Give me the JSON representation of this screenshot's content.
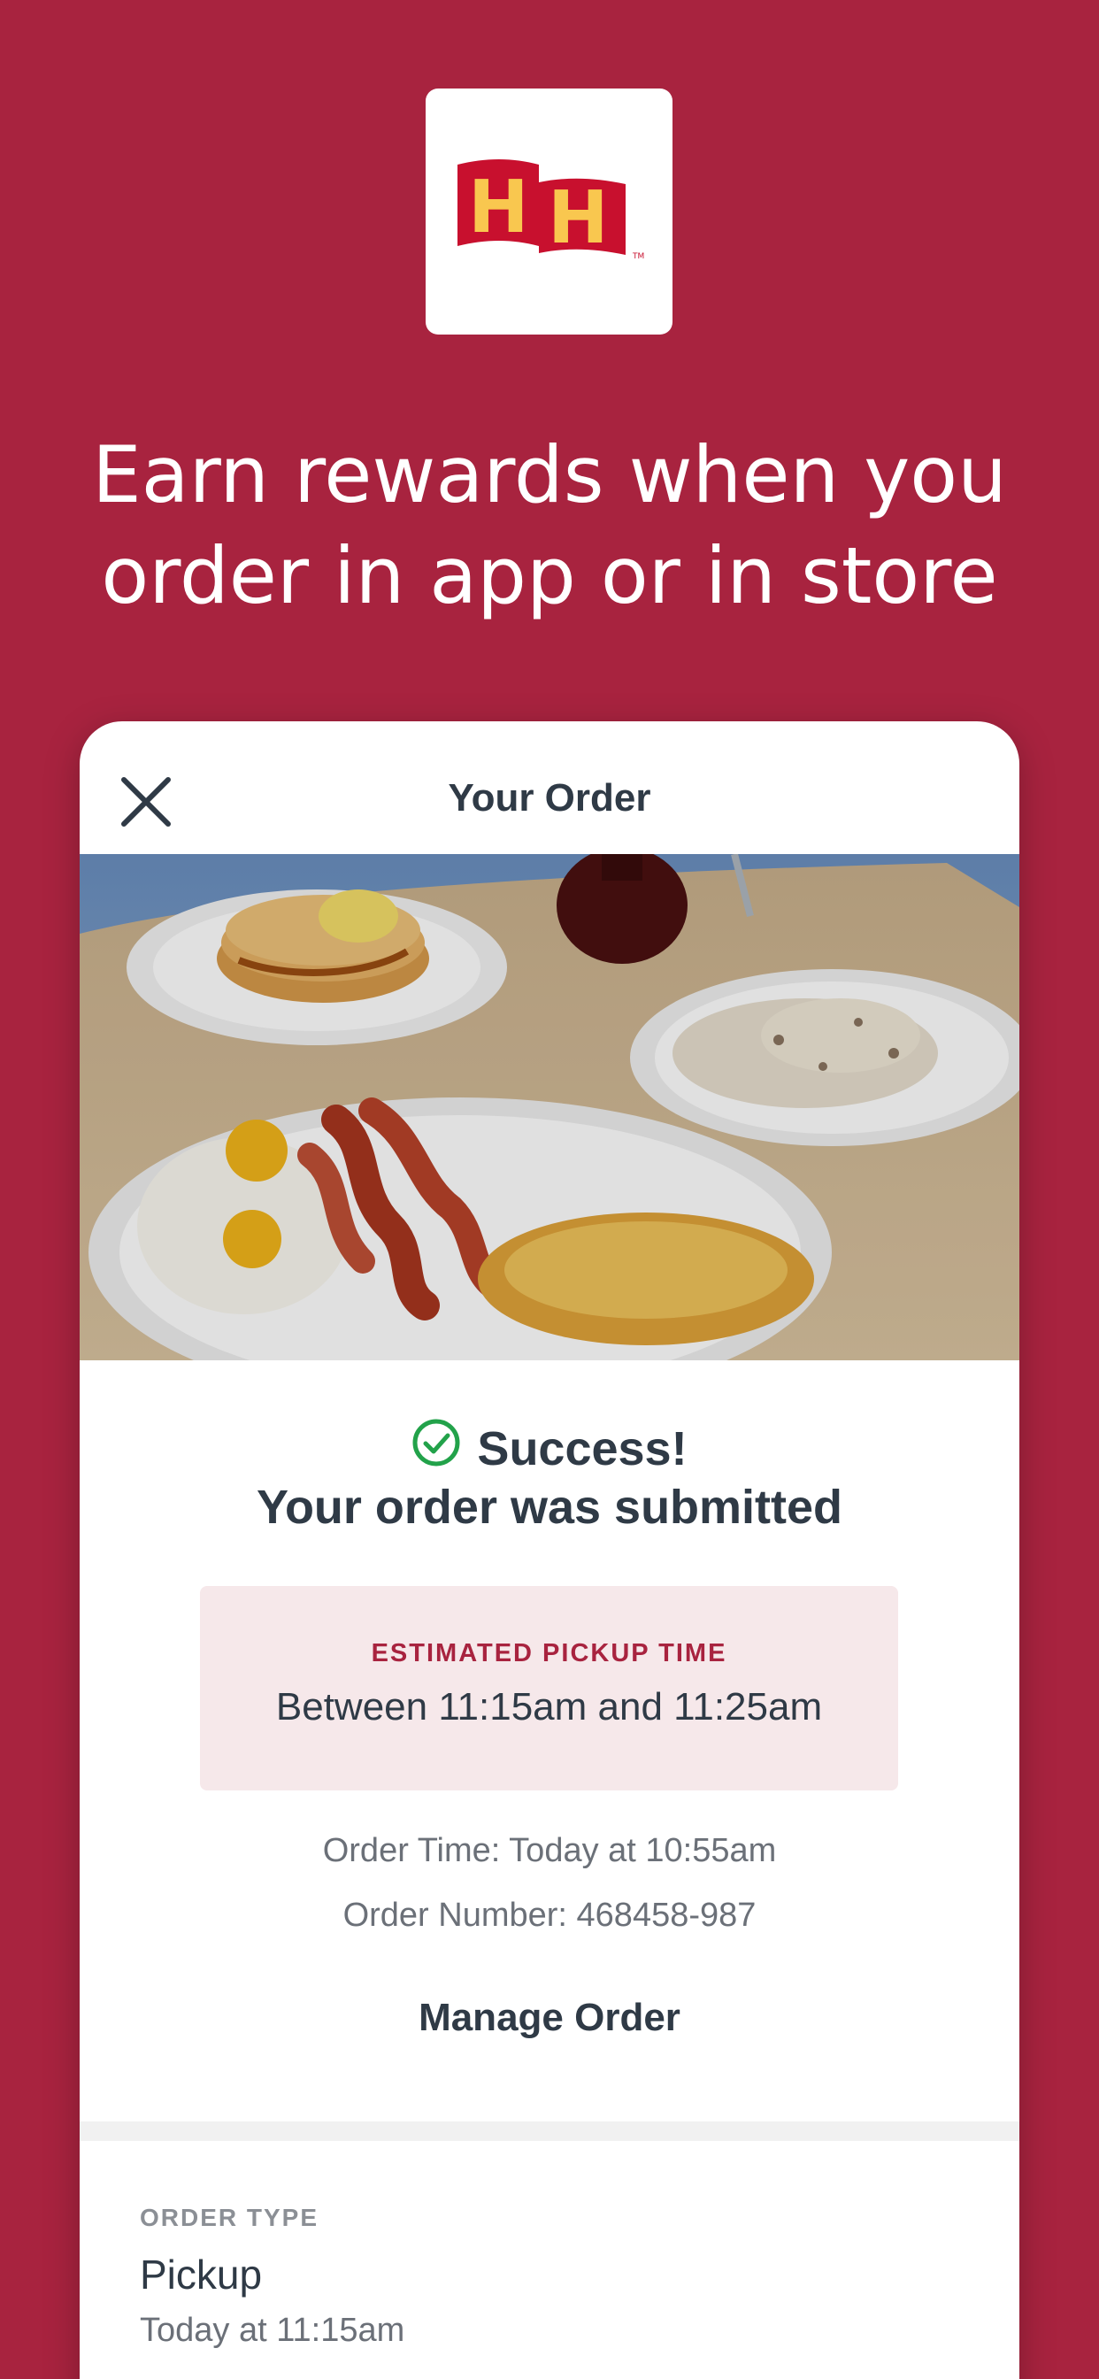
{
  "marketing": {
    "headline_line1": "Earn rewards when you",
    "headline_line2": "order in app or in store"
  },
  "brand": {
    "logo_letters": "HH",
    "logo_colors": {
      "flag": "#c8102e",
      "letters": "#f9c74f",
      "tile": "#ffffff"
    },
    "background": "#a8233f"
  },
  "order_screen": {
    "title": "Your Order",
    "close_icon": "close-icon",
    "hero_image_alt": "breakfast-plates-photo",
    "success_title": "Success!",
    "success_subtitle": "Your order was submitted",
    "success_icon": "check-circle-icon",
    "pickup": {
      "label": "ESTIMATED PICKUP TIME",
      "value": "Between 11:15am and 11:25am"
    },
    "order_time": "Order Time: Today at 10:55am",
    "order_number": "Order Number: 468458-987",
    "manage_button": "Manage Order",
    "order_type": {
      "label": "ORDER TYPE",
      "value": "Pickup",
      "time": "Today at 11:15am"
    }
  }
}
